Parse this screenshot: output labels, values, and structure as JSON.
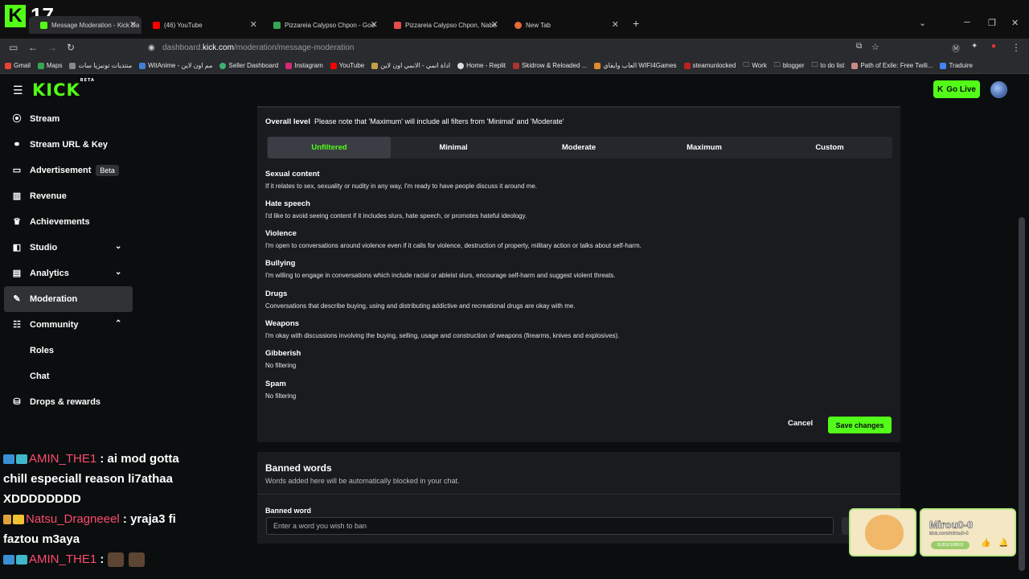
{
  "overlay": {
    "counter": "17"
  },
  "tabs": [
    {
      "title": "Message Moderation - Kick Da",
      "color": "#53fc18"
    },
    {
      "title": "(46) YouTube",
      "color": "#ff0000"
    },
    {
      "title": "Pizzareia Calypso Chpon - Goo",
      "color": "#34a853"
    },
    {
      "title": "Pizzareia Calypso Chpon, Nabe",
      "color": "#e44c4c"
    },
    {
      "title": "New Tab",
      "color": "#e66a3b"
    }
  ],
  "address": {
    "domain_pre": "dashboard.",
    "domain_main": "kick.com",
    "path": "/moderation/message-moderation"
  },
  "bookmarks": [
    "Gmail",
    "Maps",
    "منتديات تونيزيا سات",
    "WitAnime - مم اون لاين",
    "Seller Dashboard",
    "Instagram",
    "YouTube",
    "اداة انمي - الانمي اون لاين",
    "Home - Replit",
    "Skidrow & Reloaded ...",
    "العاب وايفاي WIFI4Games",
    "steamunlocked",
    "Work",
    "blogger",
    "to do list",
    "Path of Exile: Free Twili...",
    "Traduire"
  ],
  "header": {
    "logo": "KICK",
    "logo_sup": "BETA",
    "go_live": "Go Live"
  },
  "sidebar": {
    "items": [
      {
        "label": "Stream",
        "icon": "broadcast-icon"
      },
      {
        "label": "Stream URL & Key",
        "icon": "link-icon"
      },
      {
        "label": "Advertisement",
        "icon": "ad-icon",
        "badge": "Beta"
      },
      {
        "label": "Revenue",
        "icon": "chart-icon"
      },
      {
        "label": "Achievements",
        "icon": "trophy-icon"
      },
      {
        "label": "Studio",
        "icon": "studio-icon"
      },
      {
        "label": "Analytics",
        "icon": "analytics-icon"
      },
      {
        "label": "Moderation",
        "icon": "wrench-icon"
      },
      {
        "label": "Community",
        "icon": "community-icon"
      },
      {
        "label": "Roles"
      },
      {
        "label": "Chat"
      },
      {
        "label": "Drops & rewards",
        "icon": "drops-icon"
      }
    ]
  },
  "chat": [
    {
      "user": "AMIN_THE1",
      "text": ": ai mod gotta chill especiall reason li7athaa XDDDDDDDD"
    },
    {
      "user": "Natsu_Dragneeel",
      "text": ": yraja3 fi faztou m3aya"
    },
    {
      "user": "AMIN_THE1",
      "text": ":"
    }
  ],
  "moderation": {
    "overall_label": "Overall level",
    "overall_note": "Please note that 'Maximum' will include all filters from 'Minimal' and 'Moderate'",
    "levels": [
      "Unfiltered",
      "Minimal",
      "Moderate",
      "Maximum",
      "Custom"
    ],
    "selected_level": "Unfiltered",
    "categories": [
      {
        "title": "Sexual content",
        "desc": "If it relates to sex, sexuality or nudity in any way, I'm ready to have people discuss it around me."
      },
      {
        "title": "Hate speech",
        "desc": "I'd like to avoid seeing content if it includes slurs, hate speech, or promotes hateful ideology."
      },
      {
        "title": "Violence",
        "desc": "I'm open to conversations around violence even if it calls for violence, destruction of property, military action or talks about self-harm."
      },
      {
        "title": "Bullying",
        "desc": "I'm willing to engage in conversations which include racial or ableist slurs, encourage self-harm and suggest violent threats."
      },
      {
        "title": "Drugs",
        "desc": "Conversations that describe buying, using and distributing addictive and recreational drugs are okay with me."
      },
      {
        "title": "Weapons",
        "desc": "I'm okay with discussions involving the buying, selling, usage and construction of weapons (firearms, knives and explosives)."
      },
      {
        "title": "Gibberish",
        "desc": "No filtering"
      },
      {
        "title": "Spam",
        "desc": "No filtering"
      }
    ],
    "cancel": "Cancel",
    "save": "Save changes"
  },
  "banned": {
    "title": "Banned words",
    "subtitle": "Words added here will be automatically blocked in your chat.",
    "field_label": "Banned word",
    "placeholder": "Enter a word you wish to ban"
  },
  "promo": {
    "name": "Mirou0-0",
    "link": "kick.com/mirou0-0",
    "subscribe": "SUBSCRIBED"
  },
  "colors": {
    "accent": "#53fc18",
    "panel": "#191b1f",
    "background": "#0b0e0f"
  }
}
